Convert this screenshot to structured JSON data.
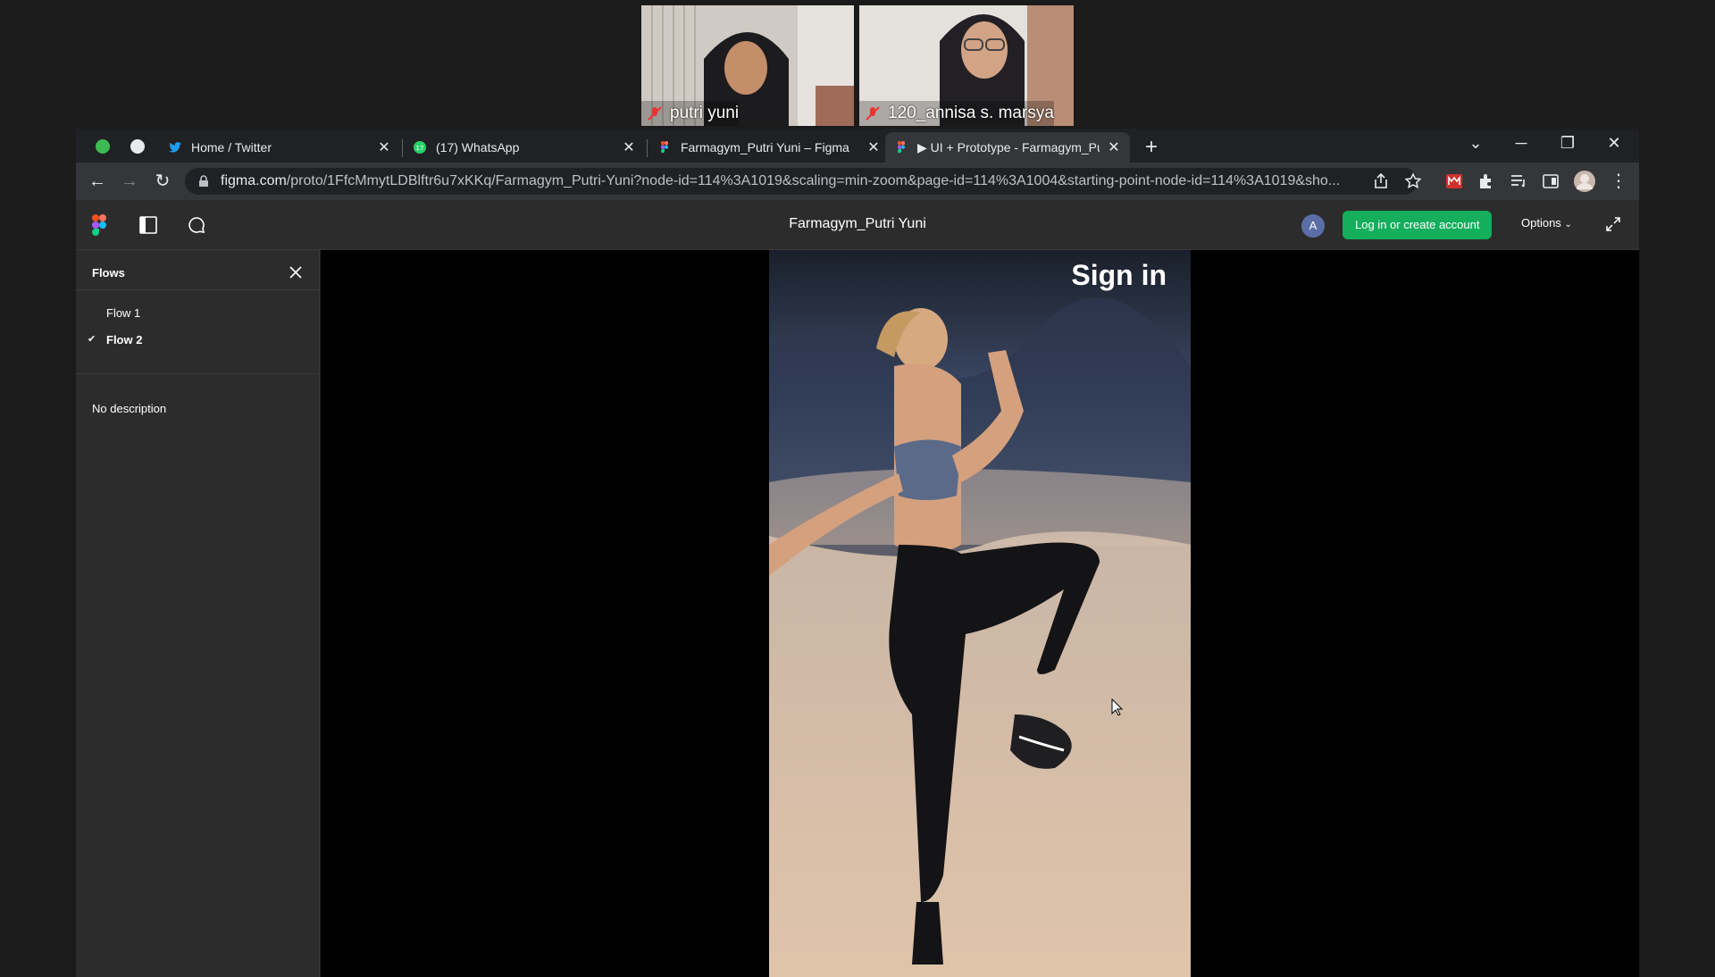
{
  "meeting": {
    "participants": [
      {
        "name": "putri yuni",
        "muted": true
      },
      {
        "name": "120_annisa s. marsya",
        "muted": true
      }
    ]
  },
  "browser": {
    "tabs": [
      {
        "title": "Home / Twitter",
        "icon": "twitter-icon",
        "active": false
      },
      {
        "title": "(17) WhatsApp",
        "icon": "whatsapp-icon",
        "active": false
      },
      {
        "title": "Farmagym_Putri Yuni – Figma",
        "icon": "figma-icon",
        "active": false
      },
      {
        "title": "▶ UI + Prototype - Farmagym_Pu",
        "icon": "figma-icon",
        "active": true
      }
    ],
    "url_host": "figma.com",
    "url_path": "/proto/1FfcMmytLDBlftr6u7xKKq/Farmagym_Putri-Yuni?node-id=114%3A1019&scaling=min-zoom&page-id=114%3A1004&starting-point-node-id=114%3A1019&sho..."
  },
  "figma": {
    "file_title": "Farmagym_Putri Yuni",
    "avatar_letter": "A",
    "login_label": "Log in or create account",
    "options_label": "Options",
    "sidebar": {
      "heading": "Flows",
      "flows": [
        {
          "label": "Flow 1",
          "selected": false
        },
        {
          "label": "Flow 2",
          "selected": true
        }
      ],
      "description": "No description"
    },
    "frame": {
      "title": "Sign in"
    }
  },
  "colors": {
    "figma_green": "#14ae5c",
    "chrome_dark": "#202124",
    "chrome_toolbar": "#35363a",
    "figma_panel": "#2c2c2c"
  }
}
